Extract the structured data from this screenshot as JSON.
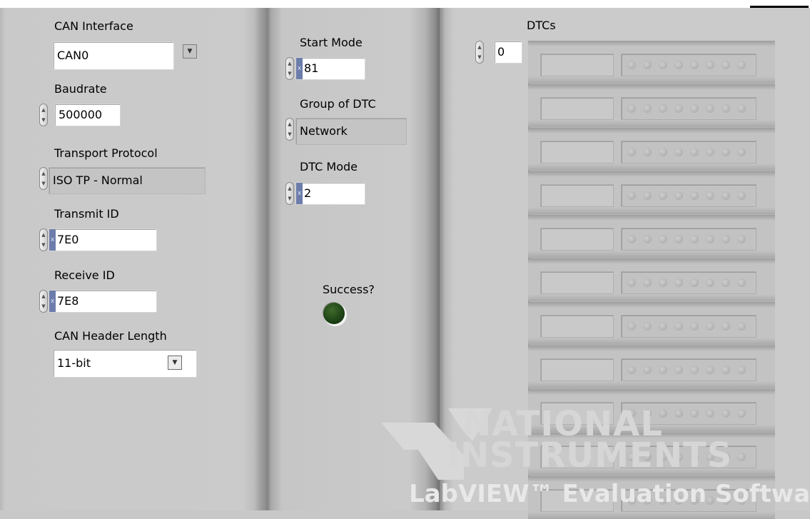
{
  "left": {
    "can_interface": {
      "label": "CAN Interface",
      "value": "CAN0"
    },
    "baudrate": {
      "label": "Baudrate",
      "value": "500000"
    },
    "transport_protocol": {
      "label": "Transport Protocol",
      "value": "ISO TP - Normal"
    },
    "transmit_id": {
      "label": "Transmit ID",
      "radix": "x",
      "value": "7E0"
    },
    "receive_id": {
      "label": "Receive ID",
      "radix": "x",
      "value": "7E8"
    },
    "can_header_length": {
      "label": "CAN Header Length",
      "value": "11-bit"
    }
  },
  "middle": {
    "start_mode": {
      "label": "Start Mode",
      "radix": "x",
      "value": "81"
    },
    "group_of_dtc": {
      "label": "Group of DTC",
      "value": "Network"
    },
    "dtc_mode": {
      "label": "DTC Mode",
      "radix": "x",
      "value": "2"
    },
    "success": {
      "label": "Success?",
      "state": false,
      "on_color": "#39c81c",
      "off_color": "#1f4517"
    }
  },
  "right": {
    "dtcs": {
      "label": "DTCs",
      "index": "0",
      "element_count": 11,
      "leds_per_element": 8
    }
  },
  "watermark": {
    "brand_line1": "NATIONAL",
    "brand_line2": "INSTRUMENTS",
    "trademark": "™",
    "product": "LabVIEW™ Evaluation Software"
  },
  "colors": {
    "panel_grey": "#c9c9c9",
    "hex_radix_marker": "#6c7dab",
    "field_white": "#ffffff"
  }
}
